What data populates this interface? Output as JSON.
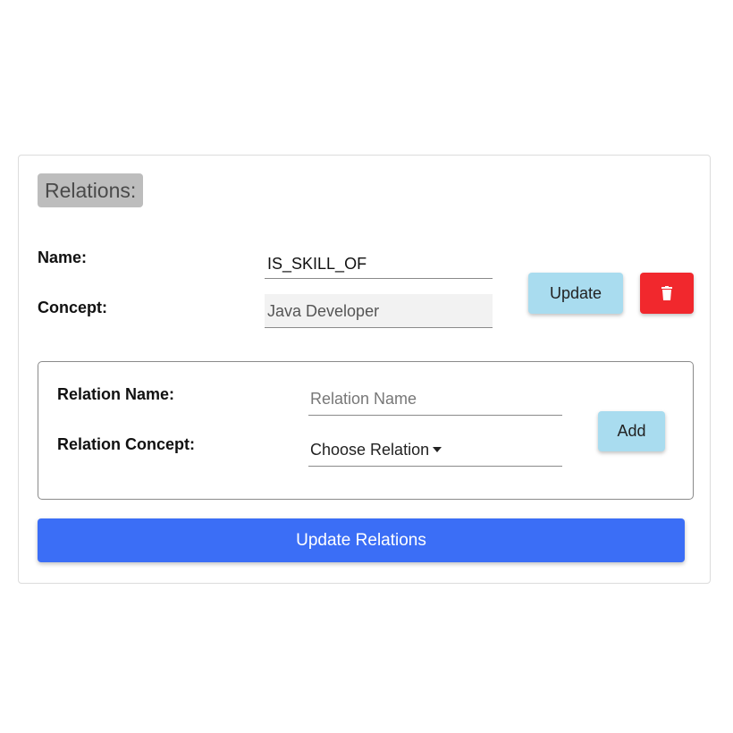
{
  "section": {
    "title": "Relations:"
  },
  "relation": {
    "name_label": "Name:",
    "name_value": "IS_SKILL_OF",
    "concept_label": "Concept:",
    "concept_value": "Java Developer",
    "update_label": "Update",
    "delete_icon": "trash-icon"
  },
  "new_relation": {
    "name_label": "Relation Name:",
    "name_placeholder": "Relation Name",
    "name_value": "",
    "concept_label": "Relation Concept:",
    "concept_selected": "Choose Relation",
    "add_label": "Add"
  },
  "footer": {
    "update_relations_label": "Update Relations"
  },
  "colors": {
    "update_button": "#a9dcef",
    "delete_button": "#f1282d",
    "primary_button": "#3b6ef6",
    "title_badge": "#bdbdbd"
  }
}
